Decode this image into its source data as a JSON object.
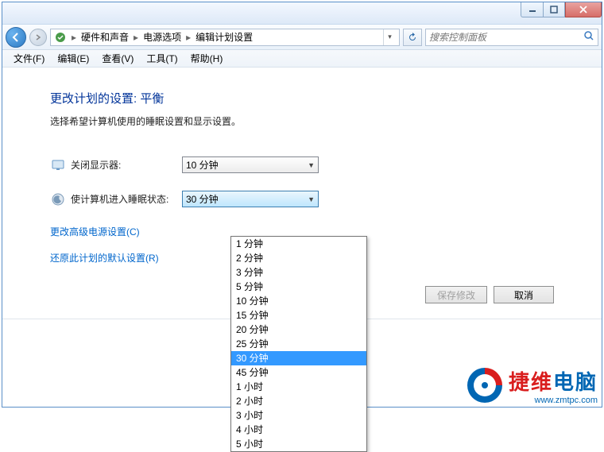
{
  "titlebar": {},
  "breadcrumb": {
    "level1": "硬件和声音",
    "level2": "电源选项",
    "level3": "编辑计划设置"
  },
  "search": {
    "placeholder": "搜索控制面板"
  },
  "menu": {
    "file": "文件(F)",
    "edit": "编辑(E)",
    "view": "查看(V)",
    "tools": "工具(T)",
    "help": "帮助(H)"
  },
  "page": {
    "title": "更改计划的设置: 平衡",
    "desc": "选择希望计算机使用的睡眠设置和显示设置。"
  },
  "settings": {
    "display_off_label": "关闭显示器:",
    "display_off_value": "10 分钟",
    "sleep_label": "使计算机进入睡眠状态:",
    "sleep_value": "30 分钟"
  },
  "links": {
    "advanced": "更改高级电源设置(C)",
    "restore": "还原此计划的默认设置(R)"
  },
  "buttons": {
    "save": "保存修改",
    "cancel": "取消"
  },
  "dropdown": {
    "items": [
      "1 分钟",
      "2 分钟",
      "3 分钟",
      "5 分钟",
      "10 分钟",
      "15 分钟",
      "20 分钟",
      "25 分钟",
      "30 分钟",
      "45 分钟",
      "1 小时",
      "2 小时",
      "3 小时",
      "4 小时",
      "5 小时"
    ],
    "selected_index": 8
  },
  "logo": {
    "text1": "捷维",
    "text2": "电脑",
    "url": "www.zmtpc.com"
  }
}
